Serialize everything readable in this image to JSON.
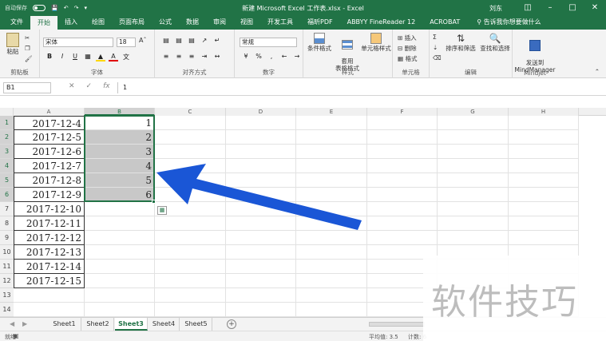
{
  "titlebar": {
    "autosave_label": "自动保存",
    "title": "新建 Microsoft Excel 工作表.xlsx  -  Excel",
    "user": "刘东"
  },
  "ribbon_tabs": [
    "文件",
    "开始",
    "插入",
    "绘图",
    "页面布局",
    "公式",
    "数据",
    "审阅",
    "视图",
    "开发工具",
    "福昕PDF",
    "ABBYY FineReader 12",
    "ACROBAT"
  ],
  "active_tab": "开始",
  "tell_me": "告诉我你想要做什么",
  "ribbon": {
    "clipboard": {
      "paste": "粘贴",
      "label": "剪贴板"
    },
    "font": {
      "name": "宋体",
      "size": "18",
      "label": "字体"
    },
    "alignment": {
      "label": "对齐方式"
    },
    "number": {
      "format": "常规",
      "label": "数字"
    },
    "styles": {
      "conditional": "条件格式",
      "table": "套用\n表格格式",
      "cell": "单元格样式",
      "label": "样式"
    },
    "cells": {
      "insert": "插入",
      "delete": "删除",
      "format": "格式",
      "label": "单元格"
    },
    "editing": {
      "sort": "排序和筛选",
      "find": "查找和选择",
      "label": "编辑"
    },
    "mindjet": {
      "send": "发送到\nMindManager",
      "label": "Mindjet"
    }
  },
  "formula_bar": {
    "name_box": "B1",
    "value": "1"
  },
  "columns": [
    "A",
    "B",
    "C",
    "D",
    "E",
    "F",
    "G",
    "H"
  ],
  "rows": [
    {
      "num": "1",
      "a": "2017-12-4",
      "b": "1"
    },
    {
      "num": "2",
      "a": "2017-12-5",
      "b": "2"
    },
    {
      "num": "3",
      "a": "2017-12-6",
      "b": "3"
    },
    {
      "num": "4",
      "a": "2017-12-7",
      "b": "4"
    },
    {
      "num": "5",
      "a": "2017-12-8",
      "b": "5"
    },
    {
      "num": "6",
      "a": "2017-12-9",
      "b": "6"
    },
    {
      "num": "7",
      "a": "2017-12-10",
      "b": ""
    },
    {
      "num": "8",
      "a": "2017-12-11",
      "b": ""
    },
    {
      "num": "9",
      "a": "2017-12-12",
      "b": ""
    },
    {
      "num": "10",
      "a": "2017-12-13",
      "b": ""
    },
    {
      "num": "11",
      "a": "2017-12-14",
      "b": ""
    },
    {
      "num": "12",
      "a": "2017-12-15",
      "b": ""
    },
    {
      "num": "13",
      "a": "",
      "b": ""
    },
    {
      "num": "14",
      "a": "",
      "b": ""
    }
  ],
  "sheets": [
    "Sheet1",
    "Sheet2",
    "Sheet3",
    "Sheet4",
    "Sheet5"
  ],
  "active_sheet": "Sheet3",
  "status": {
    "ready": "就绪",
    "average": "平均值: 3.5",
    "count": "计数: 6"
  },
  "watermark": "软件技巧",
  "colors": {
    "excel_green": "#217346",
    "selection_fill": "#c8c8c8",
    "arrow": "#1a56d6"
  }
}
